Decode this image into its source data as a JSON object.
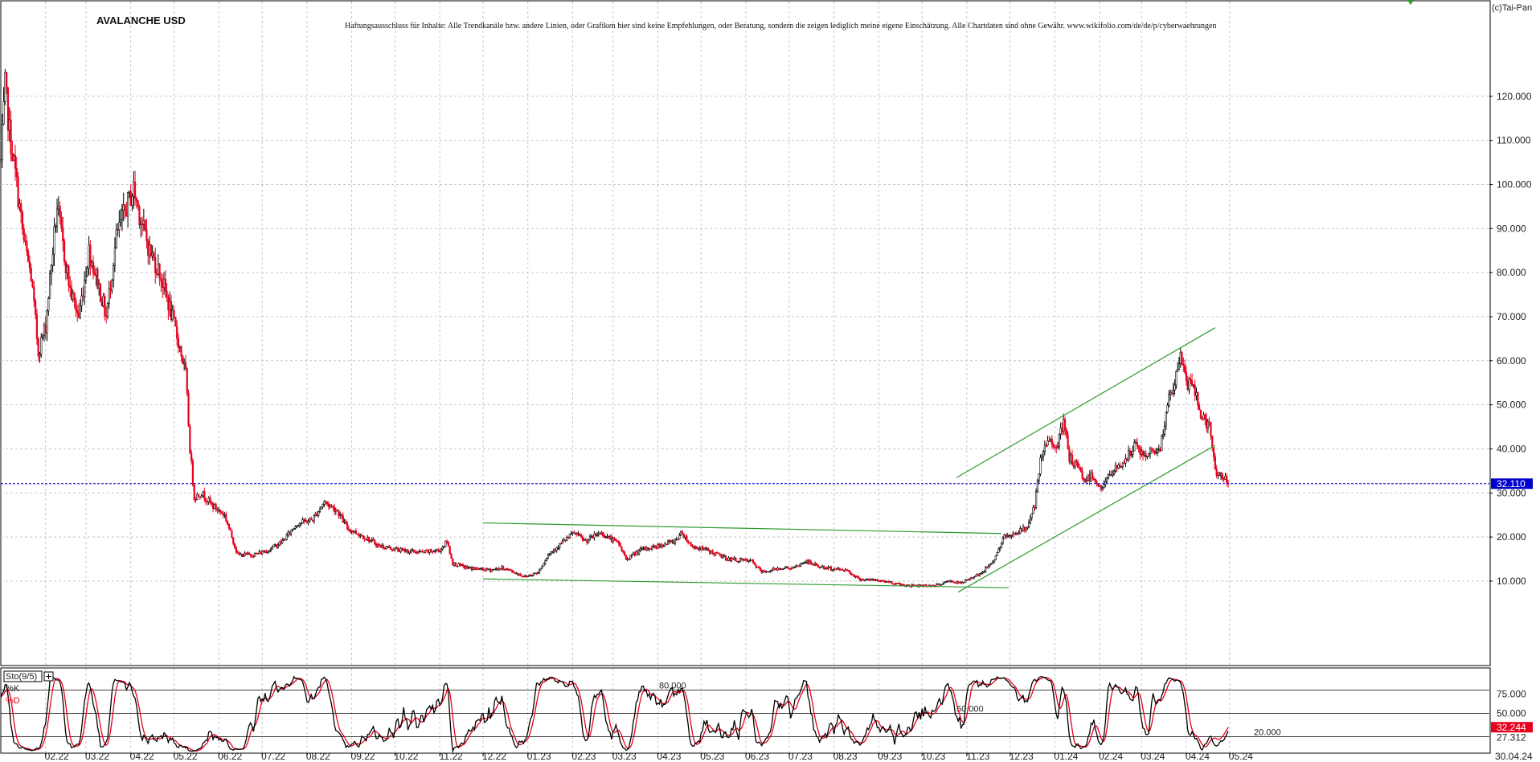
{
  "header": {
    "title": "AVALANCHE USD",
    "disclaimer": "Haftungsausschluss für Inhalte: Alle Trendkanäle bzw. andere Linien, oder Grafiken hier sind keine Empfehlungen, oder Beratung, sondern die zeigen lediglich meine eigene Einschätzung. Alle Chartdaten sind ohne Gewähr. www.wikifolio.com/de/de/p/cyberwaehrungen",
    "copyright": "(c)Tai-Pan"
  },
  "colors": {
    "up_candle": "#000000",
    "down_candle": "#e8001c",
    "channel_lines": "#2e9a2e",
    "current_price_line": "#0000cc",
    "price_badge": "#0000cc",
    "stoch_k": "#000000",
    "stoch_d": "#e8001c",
    "stoch_badge": "#e8001c"
  },
  "chart_data": [
    {
      "type": "candlestick",
      "title": "AVALANCHE USD",
      "ylim": [
        0,
        124
      ],
      "yticks": [
        "10.000",
        "20.000",
        "30.000",
        "40.000",
        "50.000",
        "60.000",
        "70.000",
        "80.000",
        "90.000",
        "100.000",
        "110.000",
        "120.000"
      ],
      "xticks": [
        "02.22",
        "03.22",
        "04.22",
        "05.22",
        "06.22",
        "07.22",
        "08.22",
        "09.22",
        "10.22",
        "11.22",
        "12.22",
        "01.23",
        "02.23",
        "03.23",
        "04.23",
        "05.23",
        "06.23",
        "07.23",
        "08.23",
        "09.23",
        "10.23",
        "11.23",
        "12.23",
        "01.24",
        "02.24",
        "03.24",
        "04.24",
        "05.24"
      ],
      "last_date": "30.04.24",
      "current_price": 32.11,
      "current_price_label": "32.110",
      "grid": true,
      "price_path": [
        [
          "2022-01-01",
          105
        ],
        [
          "2022-01-04",
          122
        ],
        [
          "2022-01-07",
          112
        ],
        [
          "2022-01-12",
          100
        ],
        [
          "2022-01-17",
          87
        ],
        [
          "2022-01-22",
          79
        ],
        [
          "2022-01-27",
          62
        ],
        [
          "2022-02-01",
          68
        ],
        [
          "2022-02-05",
          82
        ],
        [
          "2022-02-09",
          95
        ],
        [
          "2022-02-13",
          86
        ],
        [
          "2022-02-18",
          76
        ],
        [
          "2022-02-24",
          70
        ],
        [
          "2022-03-03",
          85
        ],
        [
          "2022-03-09",
          78
        ],
        [
          "2022-03-15",
          70
        ],
        [
          "2022-03-22",
          88
        ],
        [
          "2022-03-29",
          95
        ],
        [
          "2022-04-03",
          99
        ],
        [
          "2022-04-08",
          92
        ],
        [
          "2022-04-14",
          85
        ],
        [
          "2022-04-21",
          80
        ],
        [
          "2022-04-28",
          72
        ],
        [
          "2022-05-05",
          63
        ],
        [
          "2022-05-09",
          57
        ],
        [
          "2022-05-12",
          40
        ],
        [
          "2022-05-15",
          29
        ],
        [
          "2022-05-20",
          30
        ],
        [
          "2022-05-28",
          27
        ],
        [
          "2022-06-05",
          25
        ],
        [
          "2022-06-14",
          16
        ],
        [
          "2022-06-25",
          16
        ],
        [
          "2022-07-05",
          17
        ],
        [
          "2022-07-15",
          19
        ],
        [
          "2022-07-25",
          23
        ],
        [
          "2022-08-05",
          24
        ],
        [
          "2022-08-13",
          28
        ],
        [
          "2022-08-22",
          26
        ],
        [
          "2022-08-29",
          22
        ],
        [
          "2022-09-10",
          20
        ],
        [
          "2022-09-20",
          18
        ],
        [
          "2022-10-05",
          17
        ],
        [
          "2022-10-20",
          16.5
        ],
        [
          "2022-11-01",
          17
        ],
        [
          "2022-11-06",
          19
        ],
        [
          "2022-11-10",
          14
        ],
        [
          "2022-11-20",
          13
        ],
        [
          "2022-12-05",
          12.5
        ],
        [
          "2022-12-15",
          13
        ],
        [
          "2022-12-30",
          11
        ],
        [
          "2023-01-08",
          12
        ],
        [
          "2023-01-15",
          16
        ],
        [
          "2023-01-22",
          18
        ],
        [
          "2023-02-02",
          21
        ],
        [
          "2023-02-10",
          19
        ],
        [
          "2023-02-20",
          21
        ],
        [
          "2023-03-05",
          18.5
        ],
        [
          "2023-03-10",
          15
        ],
        [
          "2023-03-20",
          17
        ],
        [
          "2023-04-01",
          18
        ],
        [
          "2023-04-12",
          19
        ],
        [
          "2023-04-18",
          21
        ],
        [
          "2023-04-24",
          18
        ],
        [
          "2023-05-05",
          17
        ],
        [
          "2023-05-20",
          15
        ],
        [
          "2023-06-05",
          14.5
        ],
        [
          "2023-06-12",
          12
        ],
        [
          "2023-06-25",
          13
        ],
        [
          "2023-07-05",
          13
        ],
        [
          "2023-07-12",
          14.5
        ],
        [
          "2023-07-25",
          13
        ],
        [
          "2023-08-10",
          12.5
        ],
        [
          "2023-08-18",
          10.5
        ],
        [
          "2023-09-05",
          10
        ],
        [
          "2023-09-20",
          9
        ],
        [
          "2023-10-10",
          9
        ],
        [
          "2023-10-20",
          10
        ],
        [
          "2023-10-28",
          9.5
        ],
        [
          "2023-11-05",
          11
        ],
        [
          "2023-11-12",
          12
        ],
        [
          "2023-11-20",
          15
        ],
        [
          "2023-11-27",
          20
        ],
        [
          "2023-12-05",
          21
        ],
        [
          "2023-12-12",
          22
        ],
        [
          "2023-12-18",
          27
        ],
        [
          "2023-12-22",
          37
        ],
        [
          "2023-12-27",
          42
        ],
        [
          "2024-01-03",
          41
        ],
        [
          "2024-01-07",
          46
        ],
        [
          "2024-01-11",
          38
        ],
        [
          "2024-01-16",
          36
        ],
        [
          "2024-01-22",
          33
        ],
        [
          "2024-01-27",
          34
        ],
        [
          "2024-02-02",
          31
        ],
        [
          "2024-02-08",
          34
        ],
        [
          "2024-02-14",
          36
        ],
        [
          "2024-02-20",
          38
        ],
        [
          "2024-02-26",
          41
        ],
        [
          "2024-03-03",
          38
        ],
        [
          "2024-03-09",
          40
        ],
        [
          "2024-03-14",
          40
        ],
        [
          "2024-03-19",
          50
        ],
        [
          "2024-03-24",
          55
        ],
        [
          "2024-03-28",
          61
        ],
        [
          "2024-04-02",
          55
        ],
        [
          "2024-04-07",
          53
        ],
        [
          "2024-04-12",
          47
        ],
        [
          "2024-04-17",
          45
        ],
        [
          "2024-04-21",
          35
        ],
        [
          "2024-04-26",
          34
        ],
        [
          "2024-04-30",
          32.1
        ]
      ],
      "trend_lines": [
        {
          "name": "channel_1",
          "from": [
            "2022-12-01",
            23.2
          ],
          "to": [
            "2023-11-25",
            20.8
          ]
        },
        {
          "name": "channel_2",
          "from": [
            "2022-12-01",
            10.5
          ],
          "to": [
            "2023-11-30",
            8.5
          ]
        },
        {
          "name": "channel_3",
          "from": [
            "2023-10-25",
            33.5
          ],
          "to": [
            "2024-04-21",
            67.5
          ]
        },
        {
          "name": "channel_4",
          "from": [
            "2023-10-26",
            7.5
          ],
          "to": [
            "2024-04-21",
            40.8
          ]
        }
      ]
    },
    {
      "type": "line",
      "title": "Sto(9/5)",
      "series": [
        {
          "name": "%K"
        },
        {
          "name": "%D"
        }
      ],
      "ylim": [
        0,
        100
      ],
      "yticks": [
        "75.000",
        "50.000"
      ],
      "level_labels": [
        "80.000",
        "50.000",
        "20.000"
      ],
      "last_values": {
        "%K": 27.312,
        "%D": 32.244
      },
      "last_value_labels": {
        "%K": "27.312",
        "%D": "32.244"
      }
    }
  ]
}
